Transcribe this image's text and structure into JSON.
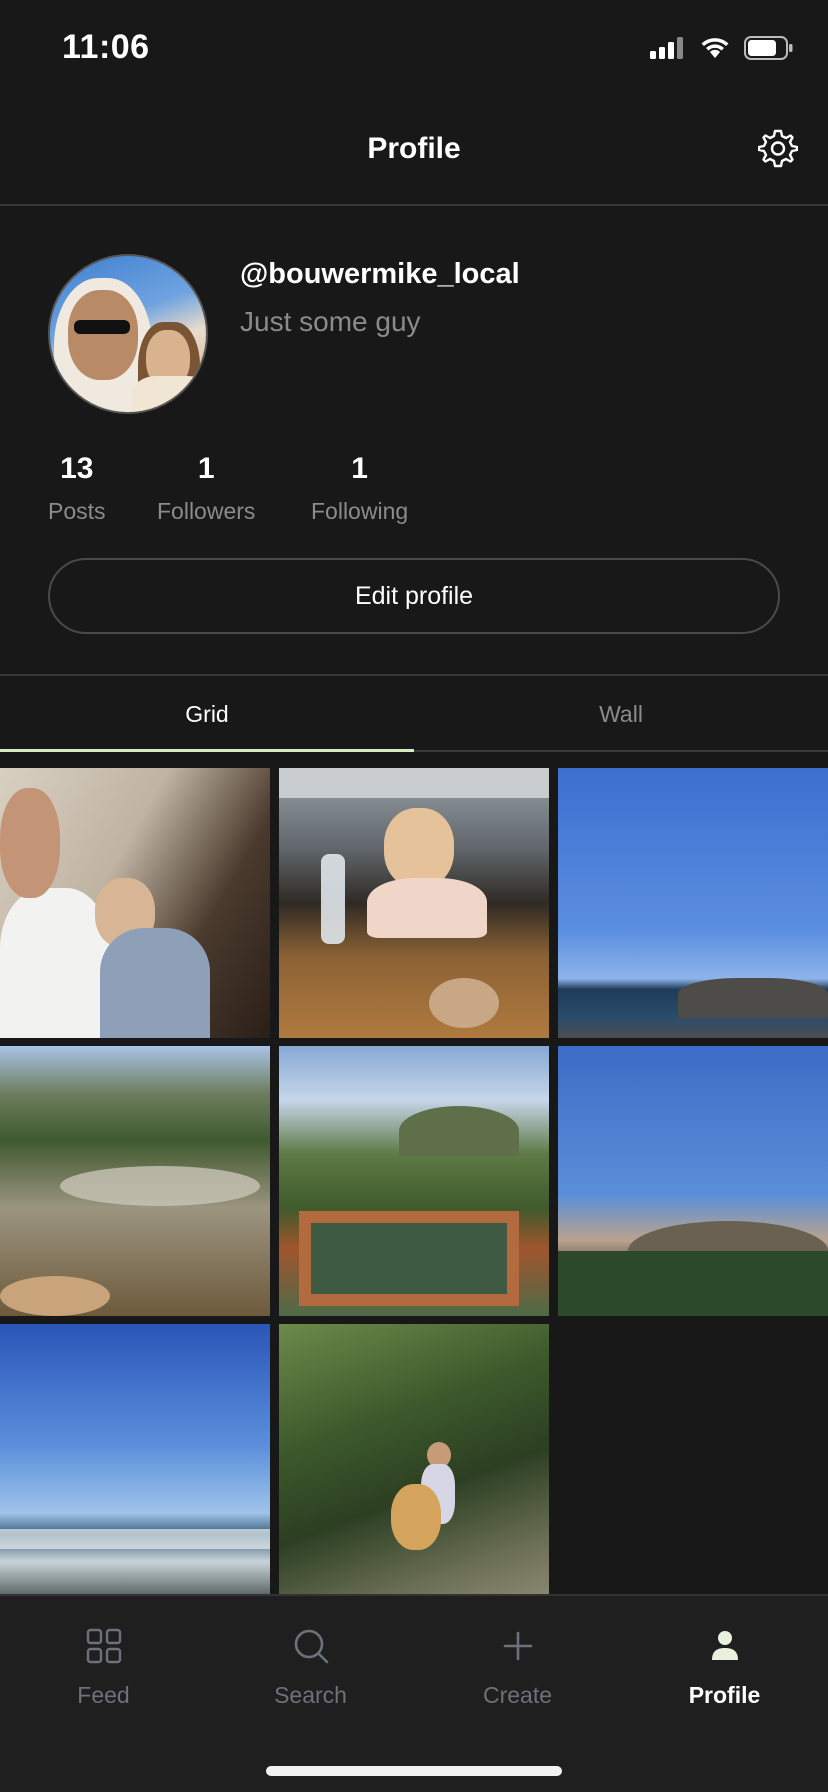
{
  "status_bar": {
    "time": "11:06"
  },
  "header": {
    "title": "Profile",
    "settings_icon": "gear-icon"
  },
  "profile": {
    "username": "@bouwermike_local",
    "bio": "Just some guy",
    "stats": [
      {
        "value": "13",
        "label": "Posts"
      },
      {
        "value": "1",
        "label": "Followers"
      },
      {
        "value": "1",
        "label": "Following"
      }
    ],
    "edit_label": "Edit profile"
  },
  "tabs": [
    {
      "label": "Grid",
      "active": true
    },
    {
      "label": "Wall",
      "active": false
    }
  ],
  "grid": {
    "photo_count": 8,
    "accent_color": "#d8eac0"
  },
  "bottom_nav": [
    {
      "label": "Feed",
      "icon": "grid-icon",
      "active": false
    },
    {
      "label": "Search",
      "icon": "search-icon",
      "active": false
    },
    {
      "label": "Create",
      "icon": "plus-icon",
      "active": false
    },
    {
      "label": "Profile",
      "icon": "person-icon",
      "active": true
    }
  ]
}
